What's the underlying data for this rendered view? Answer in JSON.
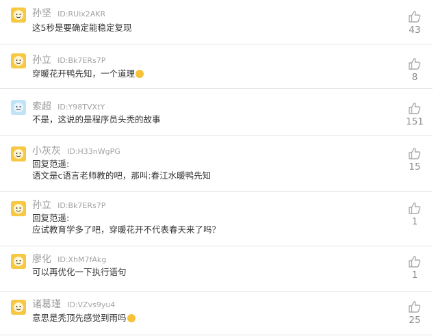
{
  "comments": [
    {
      "name": "孙坚",
      "id": "ID:RUix2AKR",
      "lines": [
        "这5秒是要确定能稳定复现"
      ],
      "likes": "43",
      "avatar_icon": "yellow-face-avatar",
      "emoji": ""
    },
    {
      "name": "孙立",
      "id": "ID:Bk7ERs7P",
      "lines": [
        "穿暖花开鸭先知，一个道理"
      ],
      "likes": "8",
      "avatar_icon": "yellow-face-avatar",
      "emoji": "laughing-emoji"
    },
    {
      "name": "索超",
      "id": "ID:Y98TVXtY",
      "lines": [
        "不是，这说的是程序员头秃的故事"
      ],
      "likes": "151",
      "avatar_icon": "blue-face-avatar",
      "emoji": ""
    },
    {
      "name": "小灰灰",
      "id": "ID:H33nWgPG",
      "lines": [
        "回复范遥:",
        "语文是c语言老师教的吧，那叫:春江水暖鸭先知"
      ],
      "likes": "15",
      "avatar_icon": "yellow-face-avatar",
      "emoji": ""
    },
    {
      "name": "孙立",
      "id": "ID:Bk7ERs7P",
      "lines": [
        "回复范遥:",
        "应试教育学多了吧，穿暖花开不代表春天来了吗？"
      ],
      "likes": "1",
      "avatar_icon": "yellow-face-avatar",
      "emoji": ""
    },
    {
      "name": "廖化",
      "id": "ID:XhM7fAkg",
      "lines": [
        "可以再优化一下执行语句"
      ],
      "likes": "1",
      "avatar_icon": "yellow-face-avatar",
      "emoji": ""
    },
    {
      "name": "诸葛瑾",
      "id": "ID:VZvs9yu4",
      "lines": [
        "意思是秃顶先感觉到雨吗"
      ],
      "likes": "25",
      "avatar_icon": "yellow-face-avatar",
      "emoji": "blushing-emoji"
    }
  ],
  "colors": {
    "avatar_yellow": "#f7c843",
    "avatar_blue": "#bfe3f7",
    "name_gray": "#9a9a9a",
    "text": "#333333"
  },
  "icons": {
    "like": "thumbs-up-icon"
  }
}
